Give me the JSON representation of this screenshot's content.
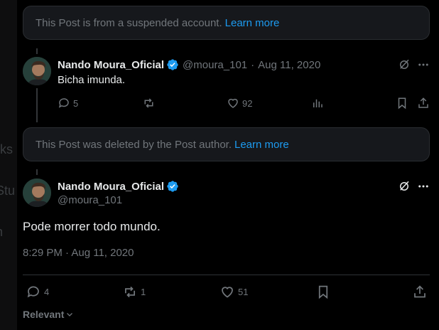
{
  "background_partial_text": [
    "rks",
    "Stu",
    "n"
  ],
  "notice_1": {
    "text": "This Post is from a suspended account.",
    "link": "Learn more"
  },
  "reply": {
    "display_name": "Nando Moura_Oficial",
    "handle": "@moura_101",
    "separator": "·",
    "date": "Aug 11, 2020",
    "text": "Bicha imunda.",
    "replies": "5",
    "likes": "92"
  },
  "notice_2": {
    "text": "This Post was deleted by the Post author.",
    "link": "Learn more"
  },
  "main_post": {
    "display_name": "Nando Moura_Oficial",
    "handle": "@moura_101",
    "text": "Pode morrer todo mundo.",
    "timestamp": "8:29 PM · Aug 11, 2020",
    "replies": "4",
    "reposts": "1",
    "likes": "51"
  },
  "sort_label": "Relevant",
  "colors": {
    "accent": "#1d9bf0",
    "muted": "#71767b",
    "text": "#e7e9ea",
    "card": "#16181c"
  }
}
